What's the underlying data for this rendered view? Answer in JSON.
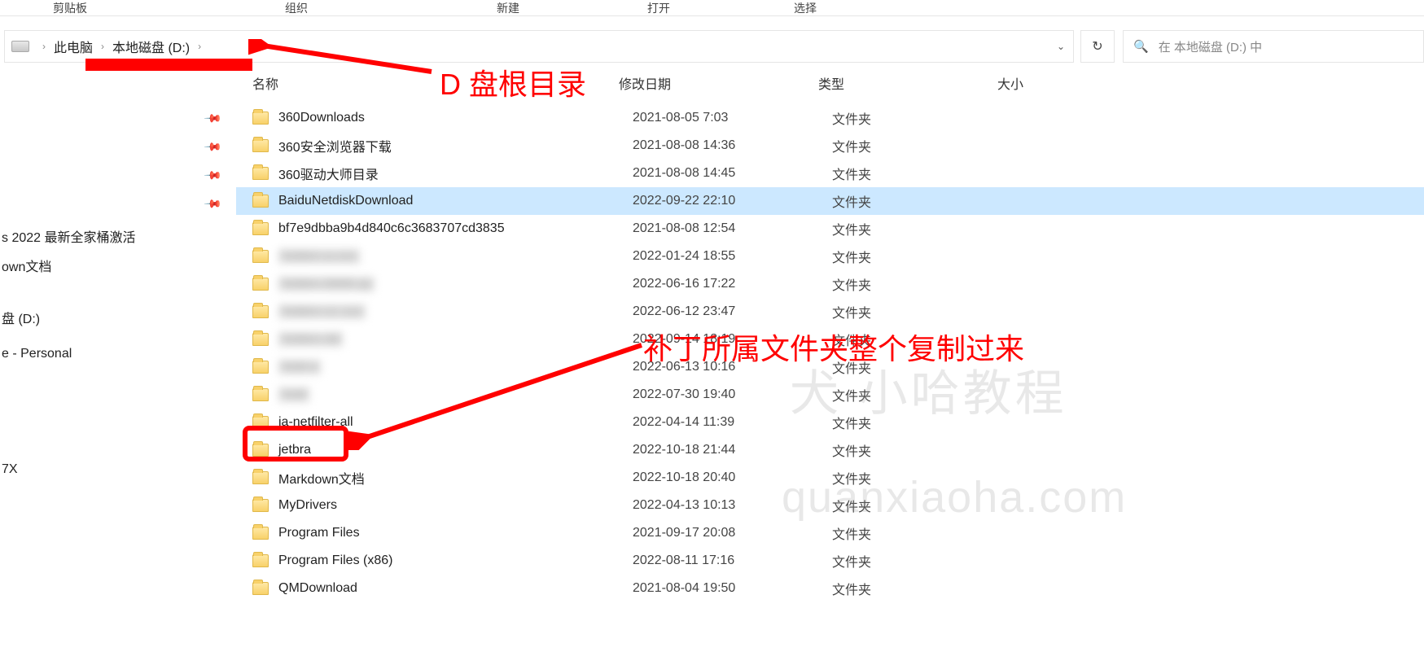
{
  "ribbon": {
    "clipboard": "剪贴板",
    "organize": "组织",
    "new": "新建",
    "open": "打开",
    "select": "选择"
  },
  "breadcrumb": {
    "pc": "此电脑",
    "drive": "本地磁盘 (D:)"
  },
  "search": {
    "placeholder": "在 本地磁盘 (D:) 中"
  },
  "columns": {
    "name": "名称",
    "date": "修改日期",
    "type": "类型",
    "size": "大小"
  },
  "sidebar": {
    "item1": "s 2022 最新全家桶激活",
    "item2": "own文档",
    "item3": "盘 (D:)",
    "item4": "e - Personal",
    "item5": "7X"
  },
  "type_folder": "文件夹",
  "files": [
    {
      "name": "360Downloads",
      "date": "2021-08-05 7:03",
      "blur": false,
      "selected": false
    },
    {
      "name": "360安全浏览器下载",
      "date": "2021-08-08 14:36",
      "blur": false,
      "selected": false
    },
    {
      "name": "360驱动大师目录",
      "date": "2021-08-08 14:45",
      "blur": false,
      "selected": false
    },
    {
      "name": "BaiduNetdiskDownload",
      "date": "2022-09-22 22:10",
      "blur": false,
      "selected": true
    },
    {
      "name": "bf7e9dbba9b4d840c6c3683707cd3835",
      "date": "2021-08-08 12:54",
      "blur": false,
      "selected": false
    },
    {
      "name": "hidden-a-xxx",
      "date": "2022-01-24 18:55",
      "blur": true,
      "selected": false
    },
    {
      "name": "hidden-bbbb-yy",
      "date": "2022-06-16 17:22",
      "blur": true,
      "selected": false
    },
    {
      "name": "hidden-cc-zzz",
      "date": "2022-06-12 23:47",
      "blur": true,
      "selected": false
    },
    {
      "name": "hidden-dd",
      "date": "2022-09-14 18:19",
      "blur": true,
      "selected": false
    },
    {
      "name": "hidd-e",
      "date": "2022-06-13 10:16",
      "blur": true,
      "selected": false
    },
    {
      "name": "hidd",
      "date": "2022-07-30 19:40",
      "blur": true,
      "selected": false
    },
    {
      "name": "ja-netfilter-all",
      "date": "2022-04-14 11:39",
      "blur": false,
      "selected": false
    },
    {
      "name": "jetbra",
      "date": "2022-10-18 21:44",
      "blur": false,
      "selected": false
    },
    {
      "name": "Markdown文档",
      "date": "2022-10-18 20:40",
      "blur": false,
      "selected": false
    },
    {
      "name": "MyDrivers",
      "date": "2022-04-13 10:13",
      "blur": false,
      "selected": false
    },
    {
      "name": "Program Files",
      "date": "2021-09-17 20:08",
      "blur": false,
      "selected": false
    },
    {
      "name": "Program Files (x86)",
      "date": "2022-08-11 17:16",
      "blur": false,
      "selected": false
    },
    {
      "name": "QMDownload",
      "date": "2021-08-04 19:50",
      "blur": false,
      "selected": false
    }
  ],
  "annotation": {
    "d_root": "D 盘根目录",
    "copy_note": "补丁所属文件夹整个复制过来"
  },
  "watermark": {
    "line1": "犬 小哈教程",
    "line2": "quanxiaoha.com"
  }
}
